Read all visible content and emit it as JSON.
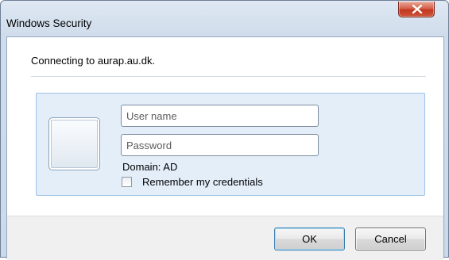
{
  "window": {
    "title": "Windows Security",
    "close_icon": "close-icon"
  },
  "dialog": {
    "message": "Connecting to aurap.au.dk."
  },
  "credentials": {
    "username_placeholder": "User name",
    "username_value": "",
    "password_placeholder": "Password",
    "password_value": "",
    "domain_text": "Domain: AD",
    "remember_label": "Remember my credentials",
    "remember_checked": false
  },
  "buttons": {
    "ok_label": "OK",
    "cancel_label": "Cancel"
  },
  "colors": {
    "panel_background": "#e3eef9",
    "panel_border": "#9cc1e8",
    "close_button": "#c2361f",
    "default_button_border": "#3c7fb1"
  }
}
